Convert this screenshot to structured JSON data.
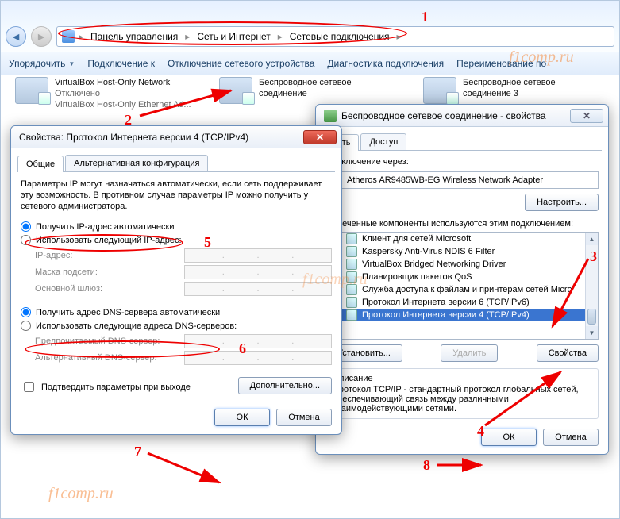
{
  "breadcrumb": {
    "seg1": "Панель управления",
    "seg2": "Сеть и Интернет",
    "seg3": "Сетевые подключения"
  },
  "toolbar": {
    "organize": "Упорядочить",
    "connect": "Подключение к",
    "disable": "Отключение сетевого устройства",
    "diag": "Диагностика подключения",
    "rename": "Переименование по"
  },
  "net1": {
    "title": "VirtualBox Host-Only Network",
    "status": "Отключено",
    "desc": "VirtualBox Host-Only Ethernet Ad..."
  },
  "net2": {
    "title": "Беспроводное сетевое",
    "title2": "соединение"
  },
  "net3": {
    "title": "Беспроводное сетевое",
    "title2": "соединение 3"
  },
  "ipv4": {
    "title": "Свойства: Протокол Интернета версии 4 (TCP/IPv4)",
    "tab1": "Общие",
    "tab2": "Альтернативная конфигурация",
    "para": "Параметры IP могут назначаться автоматически, если сеть поддерживает эту возможность. В противном случае параметры IP можно получить у сетевого администратора.",
    "r1": "Получить IP-адрес автоматически",
    "r2": "Использовать следующий IP-адрес:",
    "f1": "IP-адрес:",
    "f2": "Маска подсети:",
    "f3": "Основной шлюз:",
    "r3": "Получить адрес DNS-сервера автоматически",
    "r4": "Использовать следующие адреса DNS-серверов:",
    "f4": "Предпочитаемый DNS-сервер:",
    "f5": "Альтернативный DNS-сервер:",
    "chk": "Подтвердить параметры при выходе",
    "adv": "Дополнительно...",
    "ok": "ОК",
    "cancel": "Отмена"
  },
  "conn": {
    "title": "Беспроводное сетевое соединение - свойства",
    "tab1": "Сеть",
    "tab2": "Доступ",
    "connect_via": "Подключение через:",
    "adapter": "Atheros AR9485WB-EG Wireless Network Adapter",
    "configure": "Настроить...",
    "components": "Отмеченные компоненты используются этим подключением:",
    "c1": "Клиент для сетей Microsoft",
    "c2": "Kaspersky Anti-Virus NDIS 6 Filter",
    "c3": "VirtualBox Bridged Networking Driver",
    "c4": "Планировщик пакетов QoS",
    "c5": "Служба доступа к файлам и принтерам сетей Micro",
    "c6": "Протокол Интернета версии 6 (TCP/IPv6)",
    "c7": "Протокол Интернета версии 4 (TCP/IPv4)",
    "install": "Установить...",
    "remove": "Удалить",
    "props": "Свойства",
    "desc_title": "Описание",
    "desc": "Протокол TCP/IP - стандартный протокол глобальных сетей, обеспечивающий связь между различными взаимодействующими сетями.",
    "ok": "OК",
    "cancel": "Отмена"
  },
  "watermark": "f1comp.ru",
  "annot": {
    "n1": "1",
    "n2": "2",
    "n3": "3",
    "n4": "4",
    "n5": "5",
    "n6": "6",
    "n7": "7",
    "n8": "8"
  }
}
